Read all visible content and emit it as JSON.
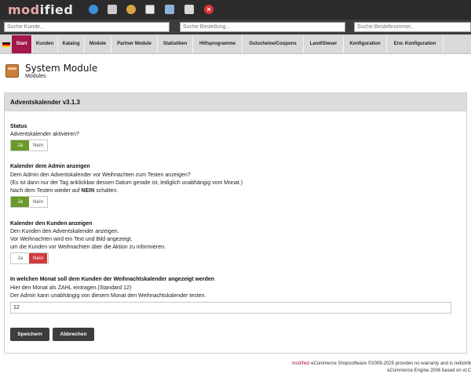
{
  "top": {
    "logo_mod": "mod",
    "logo_rest": "ified"
  },
  "search": {
    "customer_placeholder": "Suche Kunde...",
    "order_placeholder": "Suche Bestellung...",
    "order_no_placeholder": "Suche Bestellnummer..."
  },
  "nav": {
    "items": [
      {
        "label": "Start"
      },
      {
        "label": "Kunden"
      },
      {
        "label": "Katalog"
      },
      {
        "label": "Module"
      },
      {
        "label": "Partner Module"
      },
      {
        "label": "Statistiken"
      },
      {
        "label": "Hilfsprogramme"
      },
      {
        "label": "Gutscheine/Coupons"
      },
      {
        "label": "Land/Steuer"
      },
      {
        "label": "Konfiguration"
      },
      {
        "label": "Erw. Konfiguration"
      }
    ],
    "active_color": "#a3174b"
  },
  "page": {
    "title": "System Module",
    "subtitle": "Modules"
  },
  "box": {
    "title": "Adventskalender v3.1.3"
  },
  "status": {
    "heading": "Status",
    "desc": "Adventskalender aktivieren?",
    "yes": "Ja",
    "no": "Nein",
    "selected": "Ja"
  },
  "admin": {
    "heading": "Kalender dem Admin anzeigen",
    "line1": "Dem Admin den Adventskalender vor Weihnachten zum Testen anzeigen?",
    "line2": "(Es ist dann nur der Tag anklickbar dessen Datum gerade ist, lediglich unabhängig vom Monat.)",
    "line3_pre": "Nach dem Testen wieder auf ",
    "line3_bold": "NEIN",
    "line3_post": " schalten.",
    "yes": "Ja",
    "no": "Nein",
    "selected": "Ja"
  },
  "customers": {
    "heading": "Kalender den Kunden anzeigen",
    "line1": "Den Kunden den Adventskalender anzeigen.",
    "line2": "Vor Weihnachten wird ein Text und Bild angezeigt,",
    "line3": "um die Kunden vor Weihnachten über die Aktion zu informieren.",
    "yes": "Ja",
    "no": "Nein",
    "selected": "Nein"
  },
  "month": {
    "heading": "In welchen Monat soll dem Kunden der Weihnachtskalender angezeigt werden",
    "line1": "Hier den Monat als ZAHL eintragen.(Standard 12)",
    "line2": "Der Admin kann unabhängig von diesem Monat den Weihnachtskalender testen.",
    "value": "12"
  },
  "buttons": {
    "save": "Speichern",
    "cancel": "Abbrechen"
  },
  "footer": {
    "line1_brand": "modified",
    "line1_rest": " eCommerce Shopsoftware ©2009-2025 provides no warranty and is redistrib",
    "line2": "eCommerce Engine 2006 based on xt:C"
  }
}
